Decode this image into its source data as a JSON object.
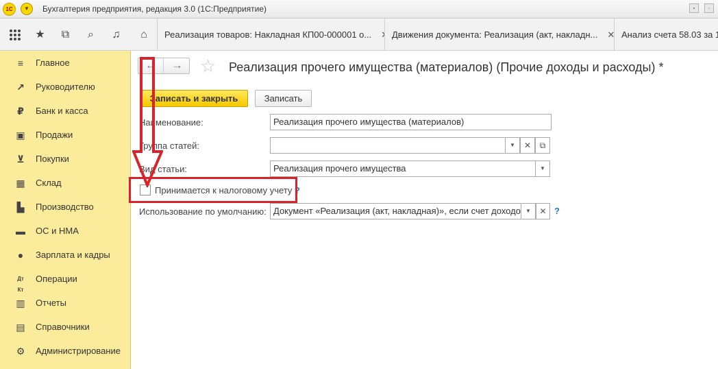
{
  "app": {
    "title": "Бухгалтерия предприятия, редакция 3.0  (1С:Предприятие)",
    "logo_text": "1С"
  },
  "toolbar": {
    "icons": [
      "apps-grid-icon",
      "star-icon",
      "history-icon",
      "search-icon",
      "bell-icon"
    ],
    "home_icon": "home-icon"
  },
  "tabs": [
    {
      "label": "Реализация товаров: Накладная КП00-000001 о...",
      "closable": true
    },
    {
      "label": "Движения документа: Реализация (акт, накладн...",
      "closable": true
    },
    {
      "label": "Анализ счета 58.03 за 1",
      "closable": false
    }
  ],
  "sidebar": {
    "items": [
      {
        "label": "Главное",
        "icon": "menu-lines-icon"
      },
      {
        "label": "Руководителю",
        "icon": "trend-up-icon"
      },
      {
        "label": "Банк и касса",
        "icon": "ruble-icon"
      },
      {
        "label": "Продажи",
        "icon": "shopping-bag-icon"
      },
      {
        "label": "Покупки",
        "icon": "cart-icon"
      },
      {
        "label": "Склад",
        "icon": "warehouse-icon"
      },
      {
        "label": "Производство",
        "icon": "factory-icon"
      },
      {
        "label": "ОС и НМА",
        "icon": "truck-icon"
      },
      {
        "label": "Зарплата и кадры",
        "icon": "person-icon"
      },
      {
        "label": "Операции",
        "icon": "dt-kt-icon"
      },
      {
        "label": "Отчеты",
        "icon": "bar-chart-icon"
      },
      {
        "label": "Справочники",
        "icon": "book-icon"
      },
      {
        "label": "Администрирование",
        "icon": "gear-icon"
      }
    ]
  },
  "form": {
    "title": "Реализация прочего имущества (материалов) (Прочие доходы и расходы) *",
    "save_close_label": "Записать и закрыть",
    "save_label": "Записать",
    "fields": {
      "name": {
        "label": "Наименование:",
        "value": "Реализация прочего имущества (материалов)"
      },
      "group": {
        "label": "Группа статей:",
        "value": ""
      },
      "kind": {
        "label": "Вид статьи:",
        "value": "Реализация прочего имущества"
      },
      "tax": {
        "label": "Принимается к налоговому учету",
        "checked": false
      },
      "default_use": {
        "label": "Использование по умолчанию:",
        "value": "Документ «Реализация (акт, накладная)», если счет доходов"
      }
    },
    "help_mark": "?"
  },
  "colors": {
    "sidebar_bg": "#fbec9c",
    "primary_button": "#f5c800",
    "annotation": "#d8232a",
    "help": "#1a7fc1"
  }
}
